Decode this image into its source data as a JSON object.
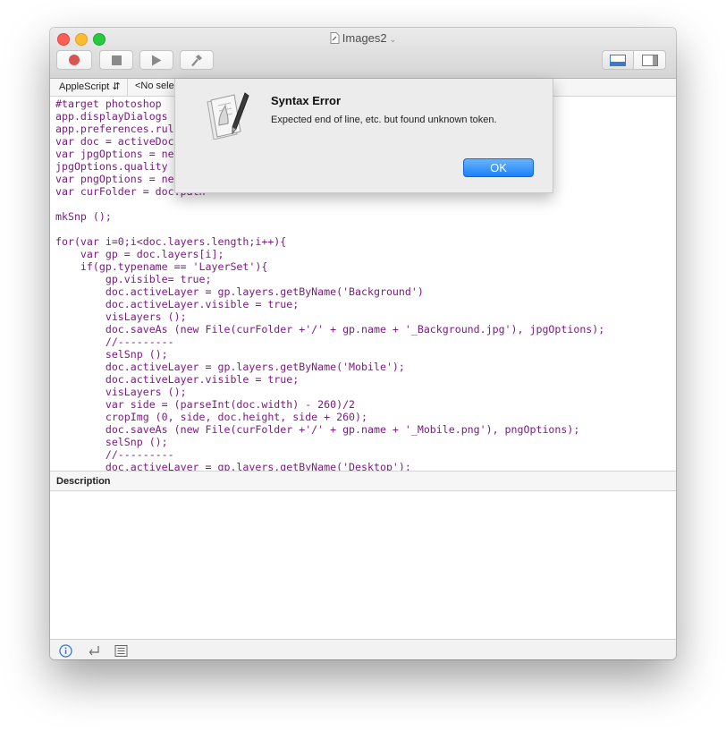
{
  "window": {
    "title": "Images2"
  },
  "toolbar": {
    "record_icon": "record-icon",
    "stop_icon": "stop-icon",
    "run_icon": "play-icon",
    "compile_icon": "hammer-icon",
    "layout_icons": [
      "bottom-panel-icon",
      "side-panel-icon"
    ]
  },
  "navbar": {
    "language": "AppleScript",
    "element_selector": "<No sele"
  },
  "code_lines": [
    "#target photoshop",
    "app.displayDialogs",
    "app.preferences.rul",
    "var doc = activeDoc",
    "var jpgOptions = ne",
    "jpgOptions.quality",
    "var pngOptions = ne",
    "var curFolder = doc.path",
    "",
    "mkSnp ();",
    "",
    "for(var i=0;i<doc.layers.length;i++){",
    "    var gp = doc.layers[i];",
    "    if(gp.typename == 'LayerSet'){",
    "        gp.visible= true;",
    "        doc.activeLayer = gp.layers.getByName('Background')",
    "        doc.activeLayer.visible = true;",
    "        visLayers ();",
    "        doc.saveAs (new File(curFolder +'/' + gp.name + '_Background.jpg'), jpgOptions);",
    "        //---------",
    "        selSnp ();",
    "        doc.activeLayer = gp.layers.getByName('Mobile');",
    "        doc.activeLayer.visible = true;",
    "        visLayers ();",
    "        var side = (parseInt(doc.width) - 260)/2",
    "        cropImg (0, side, doc.height, side + 260);",
    "        doc.saveAs (new File(curFolder +'/' + gp.name + '_Mobile.png'), pngOptions);",
    "        selSnp ();",
    "        //---------",
    "        doc.activeLayer = gp.layers.getByName('Desktop');"
  ],
  "description": {
    "header": "Description"
  },
  "bottombar": {
    "icons": [
      "info-icon",
      "return-icon",
      "list-icon"
    ]
  },
  "dialog": {
    "title": "Syntax Error",
    "message": "Expected end of line, etc. but found unknown token.",
    "ok_label": "OK",
    "icon": "script-editor-icon"
  },
  "colors": {
    "code": "#7a1c80",
    "accent": "#1a82fb"
  }
}
